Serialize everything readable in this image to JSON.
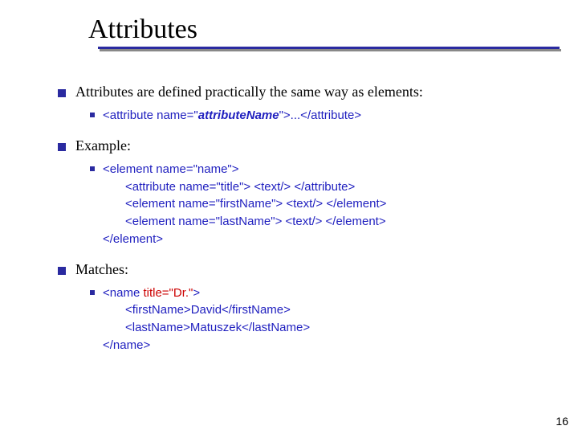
{
  "title": "Attributes",
  "bullets": {
    "b1": "Attributes are defined practically the same way as elements:",
    "b1a_open": "<attribute name=\"",
    "b1a_name": "attributeName",
    "b1a_close": "\">...</attribute>",
    "b2": "Example:",
    "b2a_l1": "<element name=\"name\">",
    "b2a_l2": "<attribute name=\"title\"> <text/> </attribute>",
    "b2a_l3": "<element name=\"firstName\"> <text/> </element>",
    "b2a_l4": "<element name=\"lastName\"> <text/> </element>",
    "b2a_l5": "</element>",
    "b3": "Matches:",
    "b3a_l1a": "<name ",
    "b3a_l1b": "title=\"Dr.\"",
    "b3a_l1c": ">",
    "b3a_l2": "<firstName>David</firstName>",
    "b3a_l3": "<lastName>Matuszek</lastName>",
    "b3a_l4": "</name>"
  },
  "page_number": "16"
}
